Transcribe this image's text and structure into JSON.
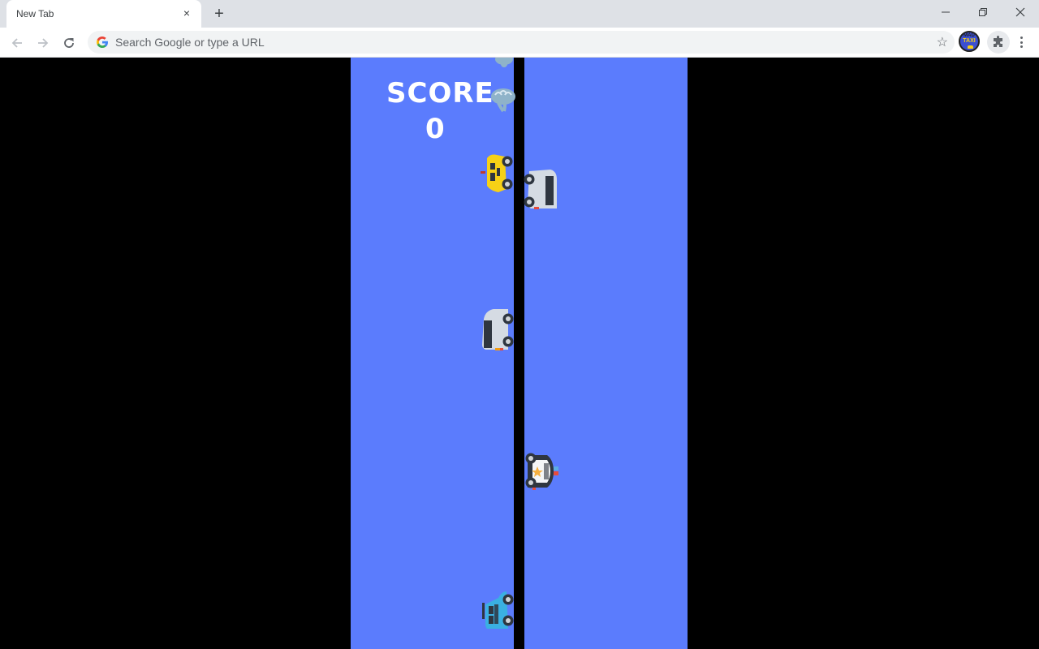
{
  "browser": {
    "tab": {
      "title": "New Tab",
      "close_icon": "×"
    },
    "new_tab_icon": "+",
    "window_controls": {
      "minimize": "—",
      "restore": "❐",
      "close": "✕"
    },
    "omnibox": {
      "placeholder": "Search Google or type a URL",
      "value": ""
    },
    "extensions": [
      {
        "name": "Mad Taxi",
        "line1": "MAD",
        "line2": "TAXI"
      },
      {
        "name": "Extensions",
        "icon": "puzzle-icon"
      }
    ]
  },
  "game": {
    "score_label": "SCORE",
    "score_value": "0",
    "colors": {
      "lane": "#5b7cfd",
      "divider": "#000000",
      "background": "#000000"
    },
    "sprites": [
      {
        "type": "smoke-cloud",
        "lane": "left",
        "partial": true
      },
      {
        "type": "smoke-cloud",
        "lane": "left"
      },
      {
        "type": "taxi",
        "color": "#f7d116",
        "lane": "left"
      },
      {
        "type": "van",
        "color": "#d5dbe3",
        "lane": "right"
      },
      {
        "type": "van",
        "color": "#d5dbe3",
        "lane": "left"
      },
      {
        "type": "police-car",
        "color": "#2f3640",
        "lane": "right"
      },
      {
        "type": "hatchback",
        "color": "#3ab0e2",
        "lane": "left"
      }
    ]
  }
}
